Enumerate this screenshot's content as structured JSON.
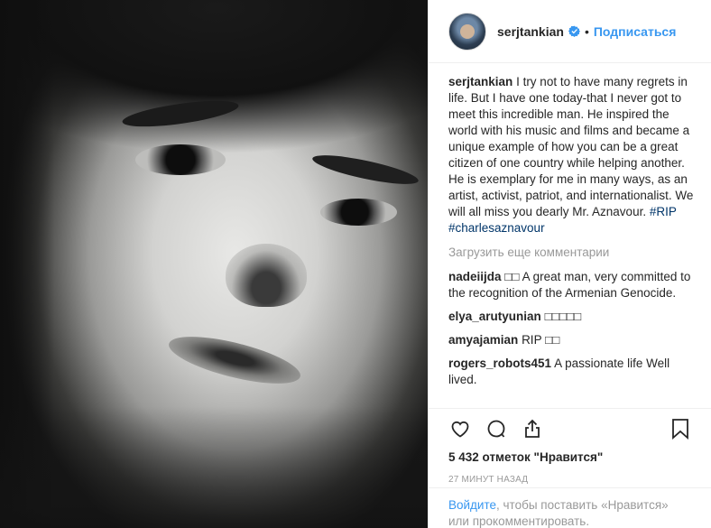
{
  "post": {
    "author": {
      "username": "serjtankian",
      "verified": true,
      "follow_label": "Подписаться",
      "dot": "•"
    },
    "caption": {
      "username": "serjtankian",
      "text": "I try not to have many regrets in life. But I have one today-that I never got to meet this incredible man. He inspired the world with his music and films and became a unique example of how you can be a great citizen of one country while helping another. He is exemplary for me in many ways, as an artist, activist, patriot, and internationalist. We will all miss you dearly Mr. Aznavour.",
      "hashtags": [
        "#RIP",
        "#charlesaznavour"
      ]
    },
    "load_more_label": "Загрузить еще комментарии",
    "comments": [
      {
        "username": "nadeiijda",
        "text": "□□ A great man, very committed to the recognition of the Armenian Genocide."
      },
      {
        "username": "elya_arutyunian",
        "text": "□□□□□"
      },
      {
        "username": "amyajamian",
        "text": "RIP □□"
      },
      {
        "username": "rogers_robots451",
        "text": "A passionate life Well lived."
      }
    ],
    "likes_text": "5 432 отметок \"Нравится\"",
    "timestamp": "27 минут назад",
    "login_prompt": {
      "link": "Войдите",
      "rest": ", чтобы поставить «Нравится» или прокомментировать."
    },
    "icons": {
      "like": "heart-icon",
      "comment": "comment-icon",
      "share": "share-icon",
      "save": "bookmark-icon",
      "verified": "verified-badge-icon"
    },
    "colors": {
      "link": "#3897f0",
      "hashtag": "#003569",
      "muted": "#999999",
      "text": "#262626"
    }
  }
}
